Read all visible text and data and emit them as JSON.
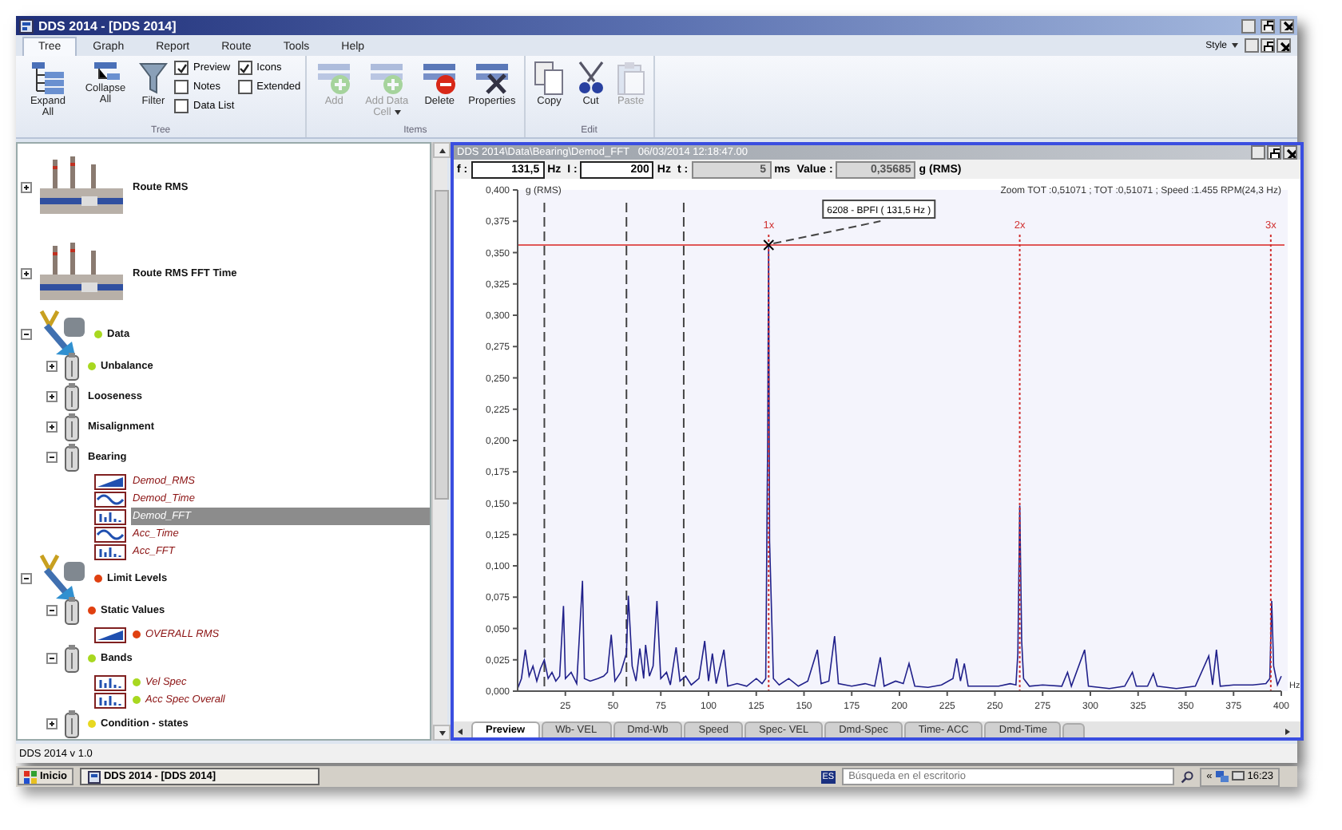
{
  "window": {
    "title": "DDS 2014 - [DDS 2014]"
  },
  "menu_tabs": [
    {
      "label": "Tree",
      "selected": true
    },
    {
      "label": "Graph",
      "selected": false
    },
    {
      "label": "Report",
      "selected": false
    },
    {
      "label": "Route",
      "selected": false
    },
    {
      "label": "Tools",
      "selected": false
    },
    {
      "label": "Help",
      "selected": false
    }
  ],
  "style_menu": {
    "label": "Style"
  },
  "ribbon": {
    "groups": [
      {
        "label": "Tree",
        "buttons": [
          {
            "kind": "expand",
            "label": "Expand All",
            "disabled": false
          },
          {
            "kind": "collapse",
            "label": "Collapse All",
            "disabled": false
          },
          {
            "kind": "filter",
            "label": "Filter",
            "disabled": false
          }
        ],
        "checkboxes": [
          [
            {
              "label": "Preview",
              "checked": true
            },
            {
              "label": "Notes",
              "checked": false
            },
            {
              "label": "Data List",
              "checked": false
            }
          ],
          [
            {
              "label": "Icons",
              "checked": true
            },
            {
              "label": "Extended",
              "checked": false
            }
          ]
        ]
      },
      {
        "label": "Items",
        "buttons": [
          {
            "kind": "add",
            "label": "Add",
            "disabled": true
          },
          {
            "kind": "add_cell",
            "label": "Add Data Cell",
            "disabled": true,
            "dropdown": true
          },
          {
            "kind": "delete",
            "label": "Delete",
            "disabled": false
          },
          {
            "kind": "properties",
            "label": "Properties",
            "disabled": false
          }
        ]
      },
      {
        "label": "Edit",
        "buttons": [
          {
            "kind": "copy",
            "label": "Copy",
            "disabled": false
          },
          {
            "kind": "cut",
            "label": "Cut",
            "disabled": false
          },
          {
            "kind": "paste",
            "label": "Paste",
            "disabled": true
          }
        ]
      }
    ]
  },
  "tree": [
    {
      "kind": "route",
      "label": "Route RMS",
      "expanded": false,
      "selected": false
    },
    {
      "kind": "route",
      "label": "Route RMS FFT Time",
      "expanded": false,
      "selected": false
    },
    {
      "kind": "machine",
      "label": "Data",
      "color": "#a8d820",
      "expanded": true,
      "selected": false,
      "children": [
        {
          "kind": "point",
          "label": "Unbalance",
          "color": "#a8d820",
          "expanded": false,
          "selected": false
        },
        {
          "kind": "point",
          "label": "Looseness",
          "expanded": false,
          "selected": false
        },
        {
          "kind": "point",
          "label": "Misalignment",
          "expanded": false,
          "selected": false
        },
        {
          "kind": "point",
          "label": "Bearing",
          "expanded": true,
          "selected": false,
          "children": [
            {
              "kind": "trend",
              "label": "Demod_RMS",
              "selected": false
            },
            {
              "kind": "time",
              "label": "Demod_Time",
              "selected": false
            },
            {
              "kind": "spectrum",
              "label": "Demod_FFT",
              "selected": true
            },
            {
              "kind": "time",
              "label": "Acc_Time",
              "selected": false
            },
            {
              "kind": "spectrum",
              "label": "Acc_FFT",
              "selected": false
            }
          ]
        }
      ]
    },
    {
      "kind": "machine",
      "label": "Limit Levels",
      "color": "#e04010",
      "expanded": true,
      "selected": false,
      "children": [
        {
          "kind": "point",
          "label": "Static Values",
          "color": "#e04010",
          "expanded": true,
          "selected": false,
          "children": [
            {
              "kind": "trend",
              "label": "OVERALL RMS",
              "color": "#e04010",
              "selected": false
            }
          ]
        },
        {
          "kind": "point",
          "label": "Bands",
          "color": "#a8d820",
          "expanded": true,
          "selected": false,
          "children": [
            {
              "kind": "spectrum",
              "label": "Vel Spec",
              "color": "#a8d820",
              "selected": false
            },
            {
              "kind": "spectrum",
              "label": "Acc Spec Overall",
              "color": "#a8d820",
              "selected": false
            }
          ]
        },
        {
          "kind": "point",
          "label": "Condition - states",
          "color": "#e8d820",
          "expanded": false,
          "selected": false
        }
      ]
    }
  ],
  "graph_window": {
    "path": "DDS 2014\\Data\\Bearing\\Demod_FFT",
    "timestamp": "06/03/2014 12:18:47.00",
    "params": [
      {
        "label": "f :",
        "value": "131,5",
        "unit": "Hz",
        "disabled": false
      },
      {
        "label": "I :",
        "value": "200",
        "unit": "Hz",
        "disabled": false
      },
      {
        "label": "t :",
        "value": "5",
        "unit": "ms",
        "disabled": true
      },
      {
        "label": "Value :",
        "value": "0,35685",
        "unit": "g  (RMS)",
        "disabled": true
      }
    ],
    "info": "Zoom TOT :0,51071 ;  TOT :0,51071 ;  Speed :1.455 RPM(24,3 Hz)",
    "chart_data": {
      "type": "line",
      "xlabel": "Hz",
      "ylabel": "g  (RMS)",
      "xlim": [
        0,
        400
      ],
      "ylim": [
        0,
        0.4
      ],
      "x": [
        0,
        2,
        4,
        6,
        8,
        10,
        12,
        14,
        16,
        18,
        20,
        22,
        24,
        25,
        28,
        31,
        34,
        35,
        38,
        42,
        45,
        47,
        49,
        51,
        54,
        57,
        58,
        60,
        62,
        64,
        66,
        67,
        69,
        71,
        73,
        75,
        78,
        80,
        83,
        85,
        88,
        91,
        95,
        98,
        100,
        102,
        104,
        108,
        110,
        115,
        120,
        125,
        128,
        130,
        131,
        131.5,
        132,
        134,
        137,
        142,
        147,
        152,
        157,
        159,
        163,
        166,
        168,
        175,
        182,
        187,
        190,
        192,
        198,
        202,
        205,
        208,
        215,
        222,
        228,
        230,
        232,
        234,
        236,
        245,
        252,
        258,
        261,
        262,
        263,
        264,
        265,
        268,
        275,
        285,
        288,
        290,
        297,
        299,
        310,
        318,
        322,
        324,
        330,
        333,
        335,
        345,
        355,
        362,
        364,
        366,
        368,
        375,
        385,
        392,
        394,
        395,
        396,
        398,
        400
      ],
      "series": [
        {
          "color": "#20208a",
          "values": [
            0.002,
            0.01,
            0.033,
            0.012,
            0.02,
            0.008,
            0.018,
            0.025,
            0.01,
            0.015,
            0.008,
            0.012,
            0.068,
            0.01,
            0.015,
            0.006,
            0.088,
            0.01,
            0.008,
            0.01,
            0.012,
            0.015,
            0.045,
            0.008,
            0.015,
            0.03,
            0.076,
            0.02,
            0.008,
            0.034,
            0.01,
            0.037,
            0.012,
            0.02,
            0.072,
            0.01,
            0.015,
            0.005,
            0.035,
            0.008,
            0.012,
            0.005,
            0.01,
            0.04,
            0.008,
            0.03,
            0.006,
            0.033,
            0.004,
            0.006,
            0.004,
            0.01,
            0.006,
            0.01,
            0.2,
            0.355,
            0.12,
            0.01,
            0.005,
            0.01,
            0.004,
            0.008,
            0.033,
            0.006,
            0.008,
            0.044,
            0.006,
            0.004,
            0.006,
            0.004,
            0.027,
            0.004,
            0.008,
            0.006,
            0.022,
            0.004,
            0.003,
            0.005,
            0.01,
            0.026,
            0.008,
            0.022,
            0.004,
            0.004,
            0.004,
            0.006,
            0.005,
            0.03,
            0.148,
            0.04,
            0.01,
            0.004,
            0.005,
            0.004,
            0.015,
            0.004,
            0.033,
            0.004,
            0.002,
            0.004,
            0.015,
            0.004,
            0.004,
            0.014,
            0.004,
            0.002,
            0.004,
            0.028,
            0.005,
            0.033,
            0.004,
            0.005,
            0.005,
            0.006,
            0.01,
            0.072,
            0.02,
            0.005,
            0.012
          ]
        }
      ],
      "xticks": [
        25,
        50,
        75,
        100,
        125,
        150,
        175,
        200,
        225,
        250,
        275,
        300,
        325,
        350,
        375,
        400
      ],
      "yticks": [
        {
          "value": 0,
          "label": "0,000"
        },
        {
          "value": 0.025,
          "label": "0,025"
        },
        {
          "value": 0.05,
          "label": "0,050"
        },
        {
          "value": 0.075,
          "label": "0,075"
        },
        {
          "value": 0.1,
          "label": "0,100"
        },
        {
          "value": 0.125,
          "label": "0,125"
        },
        {
          "value": 0.15,
          "label": "0,150"
        },
        {
          "value": 0.175,
          "label": "0,175"
        },
        {
          "value": 0.2,
          "label": "0,200"
        },
        {
          "value": 0.225,
          "label": "0,225"
        },
        {
          "value": 0.25,
          "label": "0,250"
        },
        {
          "value": 0.275,
          "label": "0,275"
        },
        {
          "value": 0.3,
          "label": "0,300"
        },
        {
          "value": 0.325,
          "label": "0,325"
        },
        {
          "value": 0.35,
          "label": "0,350"
        },
        {
          "value": 0.375,
          "label": "0,375"
        },
        {
          "value": 0.4,
          "label": "0,400"
        }
      ],
      "ref_lines": [
        {
          "axis": "x",
          "value": 14,
          "color": "#444444"
        },
        {
          "axis": "x",
          "value": 57,
          "color": "#444444"
        },
        {
          "axis": "x",
          "value": 87,
          "color": "#444444"
        },
        {
          "axis": "y",
          "value": 0.356,
          "color": "#e05858"
        },
        {
          "axis": "x",
          "value": 131.5,
          "color": "#d03030",
          "label": "1x"
        },
        {
          "axis": "x",
          "value": 263,
          "color": "#d03030",
          "label": "2x"
        },
        {
          "axis": "x",
          "value": 394.5,
          "color": "#d03030",
          "label": "3x"
        }
      ],
      "annotations": [
        {
          "x": 131.5,
          "y": 0.356,
          "text": "6208 - BPFI  ( 131,5 Hz )"
        }
      ]
    },
    "tabs": [
      {
        "label": "Preview",
        "selected": true
      },
      {
        "label": "Wb- VEL",
        "selected": false
      },
      {
        "label": "Dmd-Wb",
        "selected": false
      },
      {
        "label": "Speed",
        "selected": false
      },
      {
        "label": "Spec- VEL",
        "selected": false
      },
      {
        "label": "Dmd-Spec",
        "selected": false
      },
      {
        "label": "Time- ACC",
        "selected": false
      },
      {
        "label": "Dmd-Time",
        "selected": false
      }
    ]
  },
  "status_bar": "DDS 2014 v 1.0",
  "taskbar": {
    "start": "Inicio",
    "task": "DDS 2014 - [DDS 2014]",
    "language": "ES",
    "search": {
      "placeholder": "Búsqueda en el escritorio"
    },
    "tray_expand": "«",
    "time": "16:23"
  }
}
